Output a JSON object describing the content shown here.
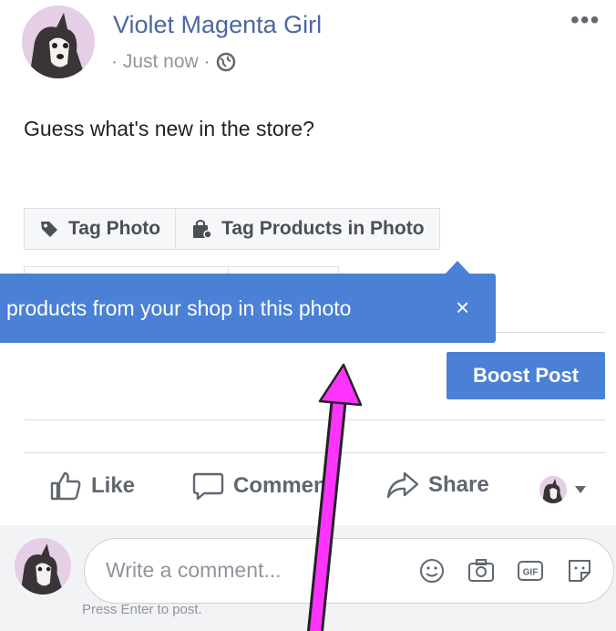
{
  "post": {
    "author": "Violet Magenta Girl",
    "timestamp": "· Just now ·",
    "privacy_icon": "globe-icon",
    "text": "Guess what's new in the store?"
  },
  "tag_buttons": {
    "tag_photo": "Tag Photo",
    "tag_products": "Tag Products in Photo"
  },
  "tooltip": {
    "text": "products from your shop in this photo",
    "close": "×"
  },
  "boost": {
    "label": "Boost Post"
  },
  "actions": {
    "like": "Like",
    "comment": "Comment",
    "share": "Share"
  },
  "comment": {
    "placeholder": "Write a comment...",
    "hint": "Press Enter to post."
  },
  "colors": {
    "brand_blue": "#4a80d6",
    "author_link": "#4b67a1",
    "annotation_arrow": "#ff33ff"
  }
}
